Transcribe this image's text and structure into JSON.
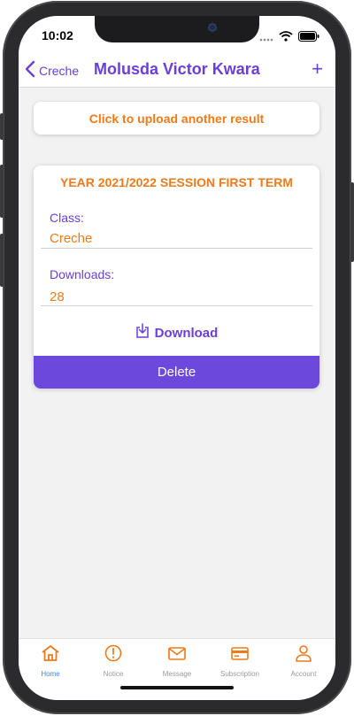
{
  "status_bar": {
    "time": "10:02"
  },
  "nav": {
    "back_label": "Creche",
    "title": "Molusda Victor Kwara",
    "add_label": "+"
  },
  "upload": {
    "label": "Click to upload another result"
  },
  "result_card": {
    "title": "YEAR 2021/2022 SESSION FIRST TERM",
    "class_label": "Class:",
    "class_value": "Creche",
    "downloads_label": "Downloads:",
    "downloads_value": "28",
    "download_label": "Download",
    "delete_label": "Delete"
  },
  "tabs": [
    {
      "label": "Home",
      "icon": "home-icon",
      "active": true
    },
    {
      "label": "Notice",
      "icon": "alert-circle-icon",
      "active": false
    },
    {
      "label": "Message",
      "icon": "envelope-icon",
      "active": false
    },
    {
      "label": "Subscription",
      "icon": "card-icon",
      "active": false
    },
    {
      "label": "Account",
      "icon": "user-icon",
      "active": false
    }
  ],
  "colors": {
    "primary": "#6a3fd8",
    "accent": "#ef7a1a",
    "active_tab": "#3f86e8",
    "delete_bg": "#6d48dd"
  }
}
